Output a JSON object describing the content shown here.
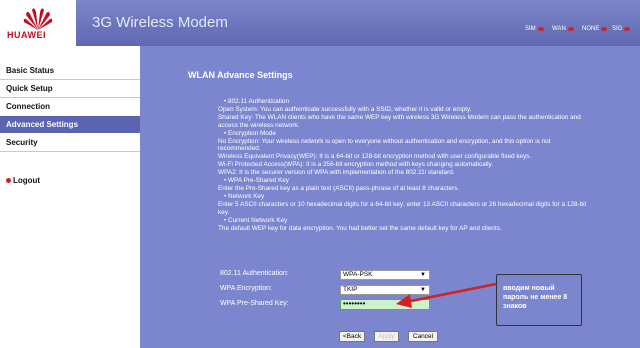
{
  "header": {
    "logo_text": "HUAWEI",
    "title": "3G Wireless Modem",
    "status": [
      {
        "label": "SIM"
      },
      {
        "label": "WAN"
      },
      {
        "label": "NONE"
      },
      {
        "label": "SIG"
      }
    ]
  },
  "sidebar": {
    "items": [
      {
        "label": "Basic Status"
      },
      {
        "label": "Quick Setup"
      },
      {
        "label": "Connection"
      },
      {
        "label": "Advanced Settings",
        "active": true
      },
      {
        "label": "Security"
      },
      {
        "label": "Logout"
      }
    ]
  },
  "main": {
    "title": "WLAN Advance Settings",
    "help": {
      "auth_head": "802.11 Authentication",
      "auth_1": "Open System: You can authenticate successfully with a SSID, whether it is valid or empty.",
      "auth_2": "Shared Key: The WLAN clients who have the same WEP key with wireless 3G Wireless Modem can pass the authentication and access the wireless network.",
      "enc_head": "Encryption Mode",
      "enc_1": "No Encryption: Your wireless network is open to everyone without authentication and encryption, and this option is not recommended.",
      "enc_2": "Wireless Equivalent Privacy(WEP): It is a 64-bit or 128-bit encryption method with user configurable fixed keys.",
      "enc_3": "Wi-Fi Protected Access(WPA): It is a 256-bit encryption method with keys changing automatically.",
      "enc_4": "WPA2: It is the securer version of WPA with implementation of the 802.11i standard.",
      "psk_head": "WPA Pre-Shared Key",
      "psk_1": "Enter the Pre-Shared key as a plain text (ASCII) pass-phrase of at least 8 characters.",
      "nk_head": "Network Key",
      "nk_1": "Enter 5 ASCII characters or 10 hexadecimal digits for a 64-bit key; enter 13 ASCII characters or 26 hexadecimal digits for a 128-bit key.",
      "cnk_head": "Current Network Key",
      "cnk_1": "The default WEP key for data encryption. You had better set the same default key for AP and clients."
    },
    "form": {
      "auth_label": "802.11 Authentication:",
      "auth_value": "WPA-PSK",
      "enc_label": "WPA Encryption:",
      "enc_value": "TKIP",
      "psk_label": "WPA Pre-Shared Key:",
      "psk_value": "••••••••"
    },
    "buttons": {
      "back": "<Back",
      "apply": "Apply",
      "cancel": "Cancel"
    },
    "annotation": "вводим новый пароль не менее 8 знаков"
  },
  "colors": {
    "header": "#6a73bb",
    "main_bg": "#7c86ce",
    "active_nav": "#5a64b0",
    "brand_red": "#c30d23",
    "arrow": "#d32020",
    "psk_field_bg": "#ccf2cc"
  },
  "icons": [
    "huawei-logo-icon",
    "sim-status-icon",
    "wan-status-icon",
    "network-status-icon",
    "signal-status-icon",
    "logout-icon",
    "dropdown-arrow-icon",
    "annotation-arrow-icon"
  ]
}
